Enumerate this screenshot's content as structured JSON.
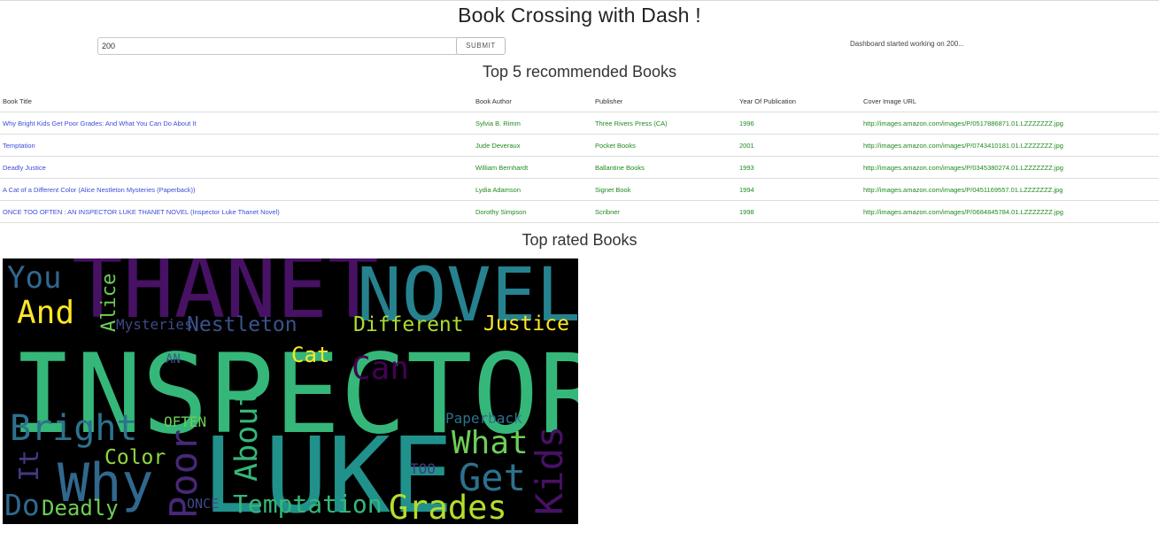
{
  "header": {
    "title": "Book Crossing with Dash !"
  },
  "controls": {
    "input_value": "200",
    "submit_label": "submit",
    "status_text": "Dashboard started working on 200..."
  },
  "recommendations": {
    "heading": "Top 5 recommended Books",
    "columns": [
      "Book Title",
      "Book Author",
      "Publisher",
      "Year Of Publication",
      "Cover Image URL"
    ],
    "rows": [
      [
        "Why Bright Kids Get Poor Grades: And What You Can Do About It",
        "Sylvia B. Rimm",
        "Three Rivers Press (CA)",
        "1996",
        "http://images.amazon.com/images/P/0517886871.01.LZZZZZZZ.jpg"
      ],
      [
        "Temptation",
        "Jude Deveraux",
        "Pocket Books",
        "2001",
        "http://images.amazon.com/images/P/0743410181.01.LZZZZZZZ.jpg"
      ],
      [
        "Deadly Justice",
        "William Bernhardt",
        "Ballantine Books",
        "1993",
        "http://images.amazon.com/images/P/0345380274.01.LZZZZZZZ.jpg"
      ],
      [
        "A Cat of a Different Color (Alice Nestleton Mysteries (Paperback))",
        "Lydia Adamson",
        "Signet Book",
        "1994",
        "http://images.amazon.com/images/P/0451169557.01.LZZZZZZZ.jpg"
      ],
      [
        "ONCE TOO OFTEN : AN INSPECTOR LUKE THANET NOVEL (Inspector Luke Thanet Novel)",
        "Dorothy Simpson",
        "Scribner",
        "1998",
        "http://images.amazon.com/images/P/0684845784.01.LZZZZZZZ.jpg"
      ]
    ]
  },
  "rated": {
    "heading": "Top rated Books",
    "wordcloud_background": "#000000",
    "words": [
      {
        "text": "THANET",
        "color": "#471164"
      },
      {
        "text": "NOVEL",
        "color": "#26828e"
      },
      {
        "text": "INSPECTOR",
        "color": "#35b779"
      },
      {
        "text": "LUKE",
        "color": "#21918c"
      },
      {
        "text": "You",
        "color": "#31688e"
      },
      {
        "text": "And",
        "color": "#fde725"
      },
      {
        "text": "Alice",
        "color": "#6ece58"
      },
      {
        "text": "Mysteries",
        "color": "#3e4989"
      },
      {
        "text": "Nestleton",
        "color": "#3b528b"
      },
      {
        "text": "Different",
        "color": "#addc30"
      },
      {
        "text": "Justice",
        "color": "#fde725"
      },
      {
        "text": "Cat",
        "color": "#fde725"
      },
      {
        "text": "Can",
        "color": "#440154"
      },
      {
        "text": "AN",
        "color": "#3b528b"
      },
      {
        "text": "Bright",
        "color": "#2c728e"
      },
      {
        "text": "OFTEN",
        "color": "#6ece58"
      },
      {
        "text": "About",
        "color": "#35b779"
      },
      {
        "text": "Paperback",
        "color": "#2c728e"
      },
      {
        "text": "What",
        "color": "#6ece58"
      },
      {
        "text": "It",
        "color": "#443983"
      },
      {
        "text": "Why",
        "color": "#31688e"
      },
      {
        "text": "Color",
        "color": "#90d743"
      },
      {
        "text": "Poor",
        "color": "#482878"
      },
      {
        "text": "TOO",
        "color": "#443983"
      },
      {
        "text": "Get",
        "color": "#2c728e"
      },
      {
        "text": "Kids",
        "color": "#471164"
      },
      {
        "text": "Do",
        "color": "#31688e"
      },
      {
        "text": "Deadly",
        "color": "#6ece58"
      },
      {
        "text": "ONCE",
        "color": "#3e4989"
      },
      {
        "text": "Temptation",
        "color": "#35b779"
      },
      {
        "text": "Grades",
        "color": "#b5de2b"
      }
    ]
  }
}
